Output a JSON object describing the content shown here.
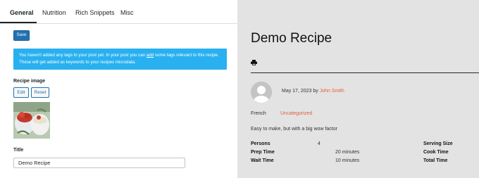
{
  "tabs": [
    {
      "label": "General"
    },
    {
      "label": "Nutrition"
    },
    {
      "label": "Rich Snippets"
    },
    {
      "label": "Misc"
    }
  ],
  "toolbar": {
    "save_label": "Save"
  },
  "notice": {
    "text_before": "You haven't added any tags to your post yet. In your post you can ",
    "link": "add",
    "text_after": " some tags relevant to this recipe. These will get added as keywords to your recipes microdata."
  },
  "recipe_image": {
    "label": "Recipe image",
    "edit_label": "Edit",
    "reset_label": "Reset"
  },
  "title_field": {
    "label": "Title",
    "value": "Demo Recipe"
  },
  "preview": {
    "title": "Demo Recipe",
    "date": "May 17, 2023",
    "by": "by",
    "author": "John Smith",
    "cuisine": "French",
    "category": "Uncategorized",
    "description": "Easy to make, but with a big wow factor",
    "stats": [
      {
        "label": "Persons",
        "value": "4"
      },
      {
        "label": "Prep Time",
        "value": "20 minutes"
      },
      {
        "label": "Wait Time",
        "value": "10 minutes"
      }
    ],
    "right_stats": [
      {
        "label": "Serving Size"
      },
      {
        "label": "Cook Time"
      },
      {
        "label": "Total Time"
      }
    ]
  },
  "colors": {
    "accent": "#2271b1",
    "notice": "#28b0f0",
    "link": "#e2603c"
  },
  "icons": [
    "print-icon",
    "avatar-placeholder-icon"
  ]
}
